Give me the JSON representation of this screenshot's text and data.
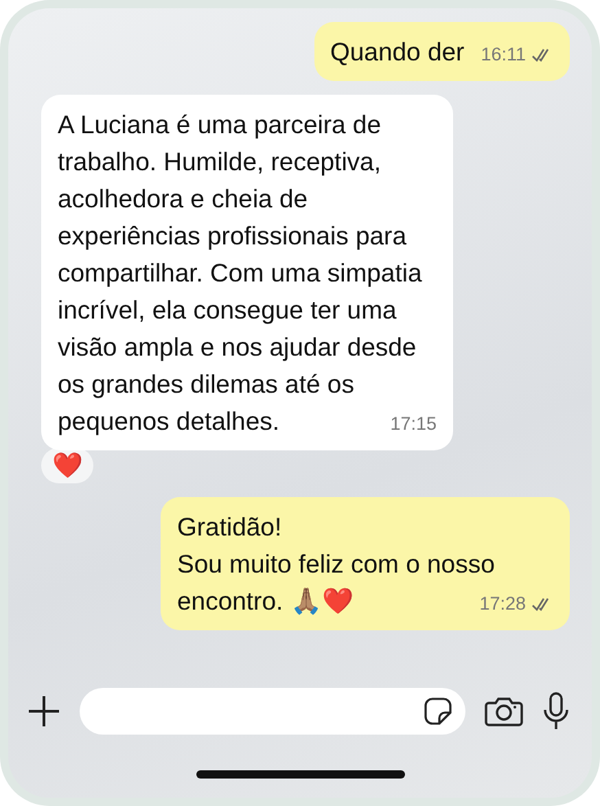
{
  "messages": [
    {
      "kind": "outgoing",
      "text": "Quando der",
      "time": "16:11"
    },
    {
      "kind": "incoming",
      "text": "A Luciana é uma parceira de trabalho. Humilde, receptiva, acolhedora e cheia de experiências profissionais para compartilhar. Com uma simpatia incrível, ela consegue ter uma visão ampla e nos ajudar desde os grandes dilemas até os pequenos detalhes.",
      "time": "17:15",
      "reaction": "❤️"
    },
    {
      "kind": "outgoing",
      "text": "Gratidão!\nSou muito feliz com o nosso encontro. 🙏🏽❤️",
      "time": "17:28"
    }
  ]
}
